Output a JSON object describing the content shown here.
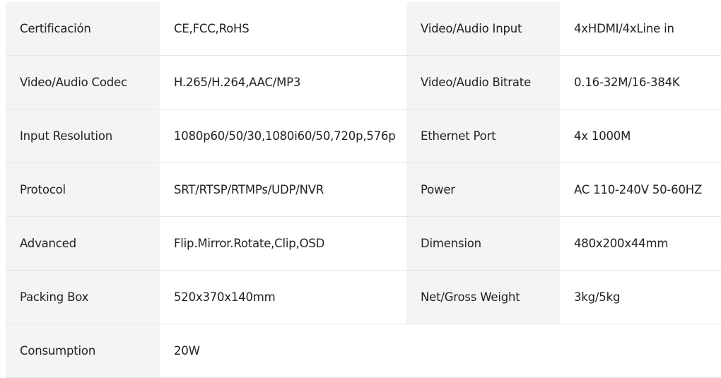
{
  "spec_table": {
    "rows": [
      {
        "left": {
          "label": "Certificación",
          "value": "CE,FCC,RoHS"
        },
        "right": {
          "label": "Video/Audio Input",
          "value": "4xHDMI/4xLine in"
        }
      },
      {
        "left": {
          "label": "Video/Audio Codec",
          "value": "H.265/H.264,AAC/MP3"
        },
        "right": {
          "label": "Video/Audio Bitrate",
          "value": "0.16-32M/16-384K"
        }
      },
      {
        "left": {
          "label": "Input Resolution",
          "value": "1080p60/50/30,1080i60/50,720p,576p"
        },
        "right": {
          "label": "Ethernet Port",
          "value": "4x 1000M"
        }
      },
      {
        "left": {
          "label": "Protocol",
          "value": "SRT/RTSP/RTMPs/UDP/NVR"
        },
        "right": {
          "label": "Power",
          "value": "AC 110-240V 50-60HZ"
        }
      },
      {
        "left": {
          "label": "Advanced",
          "value": "Flip.Mirror.Rotate,Clip,OSD"
        },
        "right": {
          "label": "Dimension",
          "value": "480x200x44mm"
        }
      },
      {
        "left": {
          "label": "Packing Box",
          "value": "520x370x140mm"
        },
        "right": {
          "label": "Net/Gross Weight",
          "value": "3kg/5kg"
        }
      },
      {
        "left": {
          "label": "Consumption",
          "value": "20W"
        },
        "right": {
          "label": "",
          "value": ""
        }
      }
    ]
  },
  "colors": {
    "label_background": "#f4f4f4",
    "value_background": "#ffffff",
    "text": "#222222",
    "border": "#e6e6e6"
  }
}
